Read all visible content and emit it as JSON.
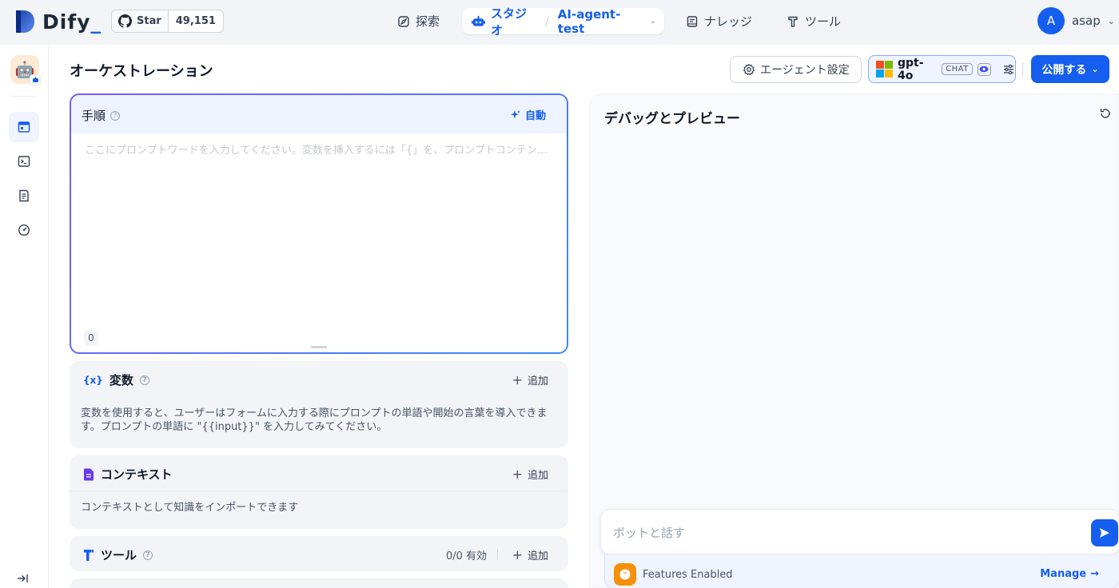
{
  "header": {
    "logo_text": "Dify",
    "github": {
      "star_label": "Star",
      "count": "49,151"
    },
    "nav": {
      "explore": "探索",
      "studio": "スタジオ",
      "app_name": "AI-agent-test",
      "knowledge": "ナレッジ",
      "tools": "ツール"
    },
    "user": {
      "initial": "A",
      "name": "asap"
    }
  },
  "sidebar": {
    "items": [
      {
        "icon": "orchestrate-icon",
        "active": true
      },
      {
        "icon": "terminal-icon",
        "active": false
      },
      {
        "icon": "logs-icon",
        "active": false
      },
      {
        "icon": "monitoring-icon",
        "active": false
      }
    ]
  },
  "toolbar": {
    "page_title": "オーケストレーション",
    "agent_settings": "エージェント設定",
    "model": {
      "name": "gpt-4o",
      "mode": "CHAT"
    },
    "publish": "公開する"
  },
  "instruction": {
    "title": "手順",
    "auto": "自動",
    "placeholder": "ここにプロンプトワードを入力してください。変数を挿入するには「{」を、プロンプトコンテンツブロックを挿入するには「/」を入力します。",
    "char_count": "0"
  },
  "variables": {
    "title": "変数",
    "add": "追加",
    "description": "変数を使用すると、ユーザーはフォームに入力する際にプロンプトの単語や開始の言葉を導入できます。プロンプトの単語に \"{{input}}\" を入力してみてください。"
  },
  "context": {
    "title": "コンテキスト",
    "add": "追加",
    "description": "コンテキストとして知識をインポートできます"
  },
  "tools": {
    "title": "ツール",
    "enabled": "0/0 有効",
    "add": "追加"
  },
  "debug": {
    "title": "デバッグとプレビュー",
    "input_placeholder": "ボットと話す",
    "features_label": "Features Enabled",
    "manage": "Manage"
  },
  "colors": {
    "primary": "#155eef",
    "background": "#f2f4f7",
    "features_orange": "#f79009"
  }
}
